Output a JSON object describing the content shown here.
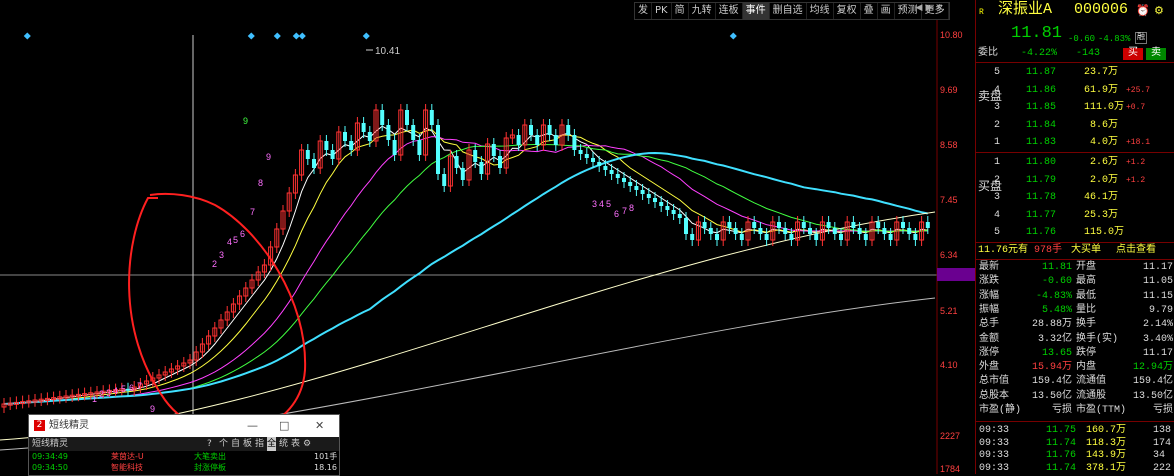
{
  "toolbar": {
    "items": [
      "发",
      "PK",
      "简",
      "九转",
      "连板",
      "事件",
      "删自选",
      "均线",
      "复权",
      "叠",
      "画",
      "预测",
      "更多"
    ],
    "active_index": 5
  },
  "price_axis": {
    "labels": [
      "10.80",
      "9.69",
      "8.58",
      "7.45",
      "6.34",
      "5.88",
      "5.21",
      "4.10",
      "2227",
      "1784"
    ]
  },
  "chart_annotations": {
    "high_label": "10.41"
  },
  "td_counts": {
    "a": [
      "1",
      "2",
      "3",
      "4",
      "5",
      "6",
      "7"
    ],
    "b": [
      "9",
      "2",
      "3",
      "4",
      "5",
      "6",
      "7",
      "8",
      "9"
    ],
    "c": [
      "9"
    ],
    "d": [
      "3",
      "4",
      "5",
      "6",
      "7",
      "8"
    ]
  },
  "quote": {
    "name": "深振业A",
    "code": "000006",
    "price": "11.81",
    "change": "-0.60",
    "pct": "-4.83%",
    "tag": "融",
    "weibi_label": "委比",
    "weibi": "-4.22%",
    "weicha": "-143",
    "buy_btn": "买",
    "sell_btn": "卖",
    "sell_side_label": "卖盘",
    "buy_side_label": "买盘",
    "sells": [
      {
        "lv": "5",
        "price": "11.87",
        "vol": "23.7万",
        "chg": ""
      },
      {
        "lv": "4",
        "price": "11.86",
        "vol": "61.9万",
        "chg": "+25.7"
      },
      {
        "lv": "3",
        "price": "11.85",
        "vol": "111.0万",
        "chg": "+0.7"
      },
      {
        "lv": "2",
        "price": "11.84",
        "vol": "8.6万",
        "chg": ""
      },
      {
        "lv": "1",
        "price": "11.83",
        "vol": "4.0万",
        "chg": "+18.1"
      }
    ],
    "buys": [
      {
        "lv": "1",
        "price": "11.80",
        "vol": "2.6万",
        "chg": "+1.2"
      },
      {
        "lv": "2",
        "price": "11.79",
        "vol": "2.0万",
        "chg": "+1.2"
      },
      {
        "lv": "3",
        "price": "11.78",
        "vol": "46.1万",
        "chg": ""
      },
      {
        "lv": "4",
        "price": "11.77",
        "vol": "25.3万",
        "chg": ""
      },
      {
        "lv": "5",
        "price": "11.76",
        "vol": "115.0万",
        "chg": ""
      }
    ],
    "bigbuy": {
      "price_text": "11.76元有",
      "hands": "978手",
      "label": "大买单",
      "link": "点击查看"
    },
    "stats": [
      {
        "l1": "最新",
        "v1": "11.81",
        "l2": "开盘",
        "v2": "11.17"
      },
      {
        "l1": "涨跌",
        "v1": "-0.60",
        "l2": "最高",
        "v2": "11.05"
      },
      {
        "l1": "涨幅",
        "v1": "-4.83%",
        "l2": "最低",
        "v2": "11.15"
      },
      {
        "l1": "振幅",
        "v1": "5.48%",
        "l2": "量比",
        "v2": "9.79"
      },
      {
        "l1": "总手",
        "v1": "28.88万",
        "l2": "换手",
        "v2": "2.14%"
      },
      {
        "l1": "金额",
        "v1": "3.32亿",
        "l2": "换手(实)",
        "v2": "3.40%"
      },
      {
        "l1": "涨停",
        "v1": "13.65",
        "l2": "跌停",
        "v2": "11.17"
      },
      {
        "l1": "外盘",
        "v1": "15.94万",
        "l2": "内盘",
        "v2": "12.94万"
      },
      {
        "l1": "总市值",
        "v1": "159.4亿",
        "l2": "流通值",
        "v2": "159.4亿"
      },
      {
        "l1": "总股本",
        "v1": "13.50亿",
        "l2": "流通股",
        "v2": "13.50亿"
      },
      {
        "l1": "市盈(静)",
        "v1": "亏损",
        "l2": "市盈(TTM)",
        "v2": "亏损"
      }
    ],
    "ticks": [
      {
        "t": "09:33",
        "p": "11.75",
        "v": "160.7万",
        "n": "138"
      },
      {
        "t": "09:33",
        "p": "11.74",
        "v": "118.3万",
        "n": "174"
      },
      {
        "t": "09:33",
        "p": "11.76",
        "v": "143.9万",
        "n": "34"
      },
      {
        "t": "09:33",
        "p": "11.74",
        "v": "378.1万",
        "n": "222"
      }
    ]
  },
  "spirit": {
    "icon": "2",
    "title": "短线精灵",
    "min": "—",
    "restore": "□",
    "close": "✕",
    "bar_label": "短线精灵",
    "bar_tabs": [
      "?",
      "个",
      "自",
      "板",
      "指",
      "全",
      "统",
      "表",
      "⚙"
    ],
    "rows": [
      {
        "time": "09:34:49",
        "stock": "莱茵达-U",
        "event": "大笔卖出",
        "val": "101手"
      },
      {
        "time": "09:34:50",
        "stock": "智能科技",
        "event": "封涨停板",
        "val": "18.16"
      }
    ]
  },
  "colors": {
    "up": "#ff3232",
    "down": "#54ffff",
    "accent": "#ffff40"
  }
}
